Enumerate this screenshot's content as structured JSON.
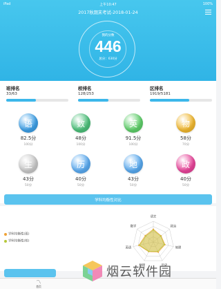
{
  "status_bar": {
    "carrier": "iPad",
    "time": "上午10:47",
    "battery": "100%"
  },
  "header": {
    "title": "2017秋期末考试-2018-01-24",
    "score_label": "我的分数",
    "total_score": "446",
    "full_score": "总分：630分"
  },
  "rankings": [
    {
      "title": "班排名",
      "value": "33/63",
      "fill_fraction": 0.48
    },
    {
      "title": "校排名",
      "value": "128/253",
      "fill_fraction": 0.49
    },
    {
      "title": "区排名",
      "value": "1919/5181",
      "fill_fraction": 0.63
    }
  ],
  "subjects": [
    {
      "name": "语",
      "score": "82.5分",
      "full": "100分",
      "color": "#3d9fe6"
    },
    {
      "name": "数",
      "score": "48分",
      "full": "100分",
      "color": "#4cc07a"
    },
    {
      "name": "英",
      "score": "91.5分",
      "full": "100分",
      "color": "#5fcf6a"
    },
    {
      "name": "物",
      "score": "58分",
      "full": "70分",
      "color": "#f1b830"
    },
    {
      "name": "生",
      "score": "43分",
      "full": "50分",
      "color": "#c8c8c8"
    },
    {
      "name": "历",
      "score": "40分",
      "full": "50分",
      "color": "#5aaaf0"
    },
    {
      "name": "地",
      "score": "43分",
      "full": "50分",
      "color": "#58a9ef"
    },
    {
      "name": "政",
      "score": "40分",
      "full": "50分",
      "color": "#e8459a"
    }
  ],
  "compare_button": "学科均衡性对比",
  "legend": [
    {
      "label": "学科均衡性(班)",
      "color": "#f0a235"
    },
    {
      "label": "学科均衡性(校)",
      "color": "#b6c83a"
    }
  ],
  "radar": {
    "axes": [
      "语文",
      "政治",
      "地理",
      "历史",
      "物理",
      "英语",
      "数学"
    ],
    "series_class": [
      0.62,
      0.48,
      0.58,
      0.55,
      0.52,
      0.72,
      0.5
    ],
    "series_school": [
      0.58,
      0.45,
      0.55,
      0.5,
      0.5,
      0.68,
      0.46
    ]
  },
  "tab_bar": {
    "tab_label": "首页"
  },
  "watermark": "烟云软件园"
}
